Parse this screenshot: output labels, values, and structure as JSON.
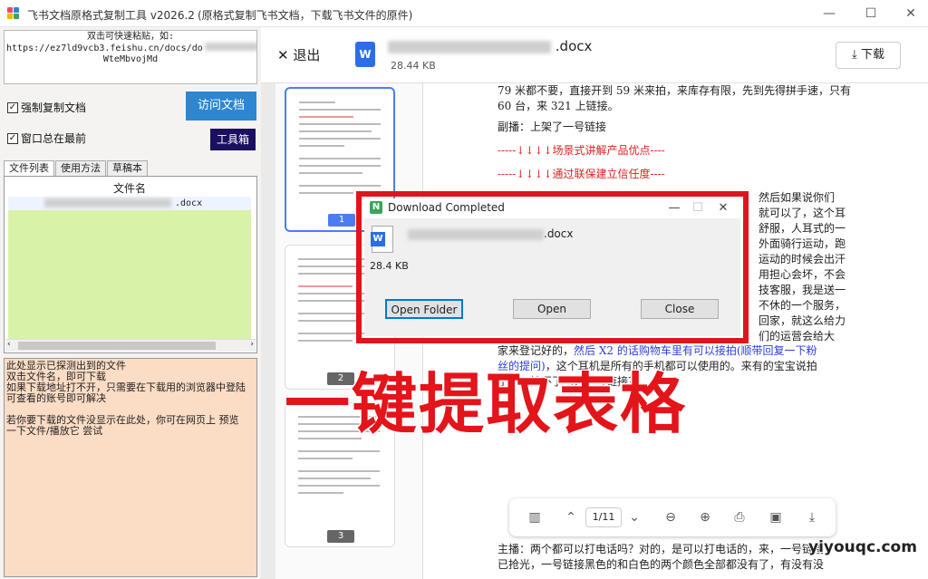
{
  "window": {
    "title": "飞书文档原格式复制工具 v2026.2",
    "subtitle": "(原格式复制飞书文档，下载飞书文件的原件)"
  },
  "left": {
    "url_box_lines": [
      "双击可快速粘贴，如:",
      "https://ez7ld9vcb3.feishu.cn/docs/do",
      "WteMbvojMd"
    ],
    "force_copy": "强制复制文档",
    "always_top": "窗口总在最前",
    "visit_button": "访问文档",
    "toolbox_button": "工具箱",
    "tabs": [
      "文件列表",
      "使用方法",
      "草稿本"
    ],
    "file_list": {
      "header": "文件名",
      "rows": [
        ".docx"
      ]
    },
    "info_lines": [
      "此处显示已探测出到的文件",
      "双击文件名，即可下载",
      "如果下载地址打不开，只需要在下载用的浏览器中登陆",
      "可查看的账号即可解决",
      "",
      "若你要下载的文件没显示在此处，你可在网页上 预览",
      "一下文件/播放它 尝试"
    ]
  },
  "doc": {
    "exit_label": "退出",
    "file_ext": ".docx",
    "file_size": "28.44 KB",
    "download_label": "下载",
    "pages": [
      "1",
      "2",
      "3"
    ],
    "page_indicator": "1/11",
    "text": {
      "p1": "79 米都不要，直接开到 59 米来拍，来库存有限，先到先得拼手速，只有 60 台，来 321 上链接。",
      "p2": "副播：上架了一号链接",
      "r1": "-----↓↓↓↓场景式讲解产品优点----",
      "r2": "-----↓↓↓↓通过联保建立信任度----",
      "right1": "然后如果说你们",
      "right2": "就可以了，这个耳",
      "right3": "舒服，人耳式的一",
      "right4": "外面骑行运动，跑",
      "right5": "运动的时候会出汗",
      "right6": "用担心会坏，不会",
      "right7": "技客服，我是送一",
      "right8": "不休的一个服务，",
      "right9": "回家，就这么给力",
      "right10": "们的运营会给大",
      "l1a": "家来登记好的，",
      "l1b": "然后 X2 的话购物车里有可以接拍",
      "l1c": "(顺带回复一下粉",
      "l2a": "丝的提问)",
      "l2b": "，这个耳机是所有的手机都可以使用的。来有的宝宝说拍",
      "l3": "了不，拍不了吗？一号链接？",
      "bottom1": "主播：两个都可以打电话吗？对的，是可以打电话的，来，一号链接",
      "bottom2": "已抢光，一号链接黑色的和白色的两个颜色全部都没有了，有没有没"
    }
  },
  "dialog": {
    "title": "Download Completed",
    "file_ext": ".docx",
    "size": "28.4 KB",
    "buttons": [
      "Open Folder",
      "Open",
      "Close"
    ]
  },
  "overlay": {
    "caption": "一键提取表格",
    "watermark": "yiyouqc.com"
  },
  "colors": {
    "accent_red": "#e0141b",
    "visit_blue": "#2e86d0",
    "toolbox_navy": "#1a1060",
    "list_green": "#d8f2a8",
    "info_peach": "#fbdcc4"
  }
}
